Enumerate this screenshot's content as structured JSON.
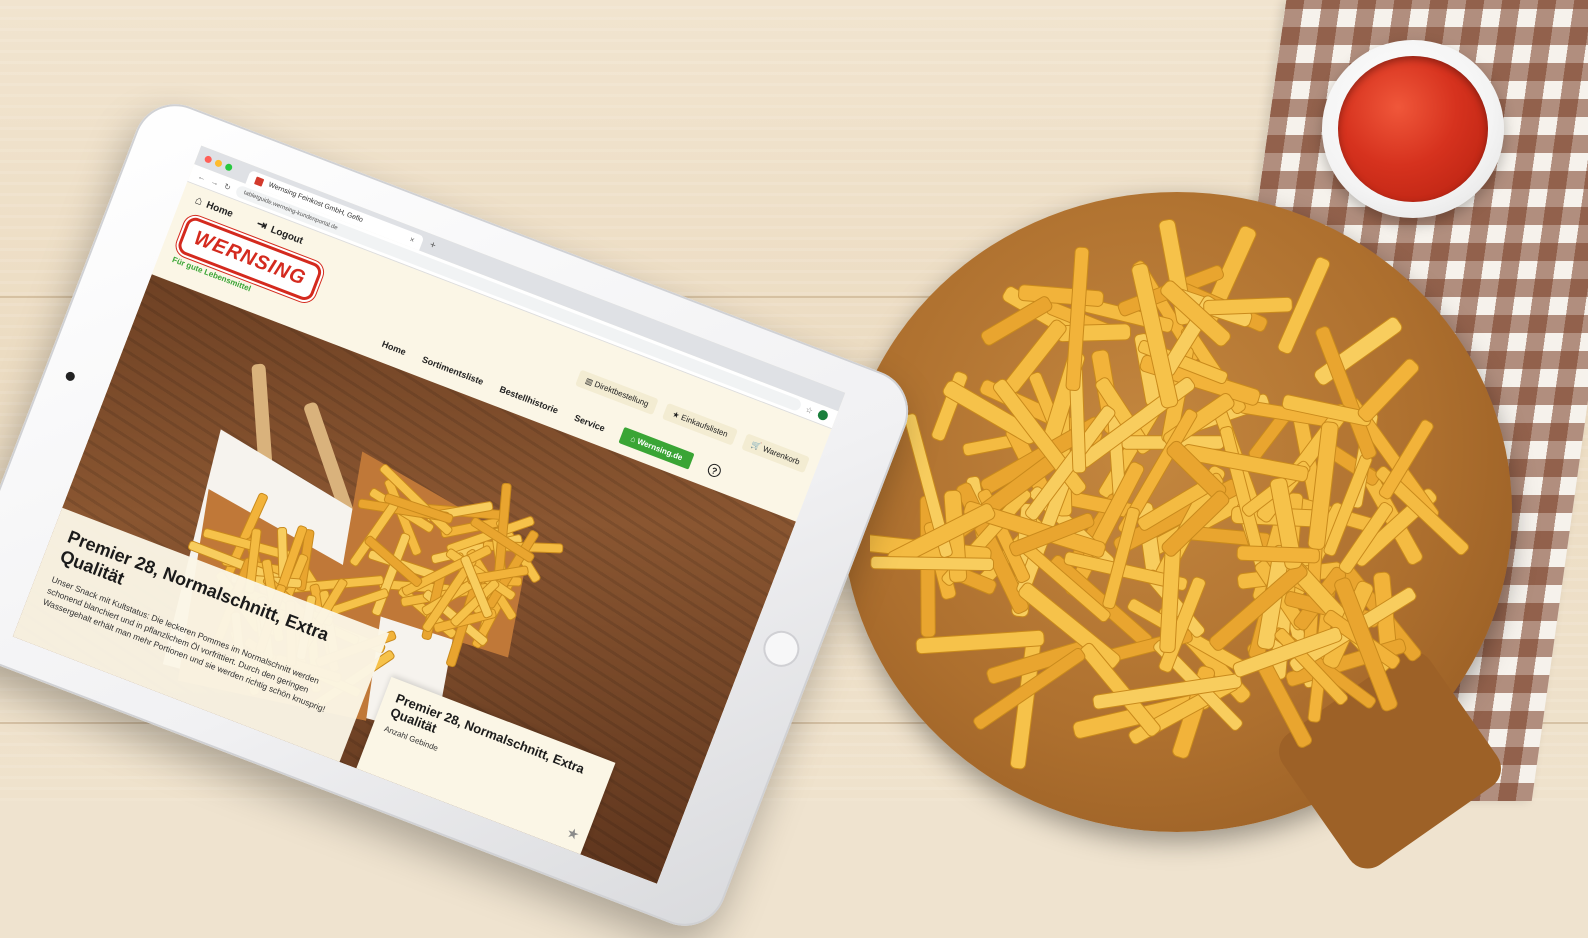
{
  "browser": {
    "tab_title": "Wernsing Feinkost GmbH, Geflo",
    "new_tab_symbol": "+",
    "url": "tabletguide.wernsing-kundenportal.de"
  },
  "site": {
    "top_nav": {
      "home_label": "Home",
      "logout_label": "Logout"
    },
    "logo_text": "WERNSING",
    "tagline": "Für gute Lebensmittel",
    "util": {
      "direct_order_label": "Direktbestellung",
      "shopping_list_label": "Einkaufslisten",
      "cart_label": "Warenkorb"
    },
    "main_nav": {
      "home": "Home",
      "assortment": "Sortimentsliste",
      "order_history": "Bestellhistorie",
      "service": "Service",
      "wernsing_button": "Wernsing.de",
      "help_symbol": "?"
    },
    "hero": {
      "title": "Premier 28, Normalschnitt, Extra Qualität",
      "description": "Unser Snack mit Kultstatus: Die leckeren Pommes im Normalschnitt werden schonend blanchiert und in pflanzlichem Öl vorfrittiert. Durch den geringen Wassergehalt erhält man mehr Portionen und sie werden richtig schön knusprig!"
    },
    "card": {
      "title": "Premier 28, Normalschnitt, Extra Qualität",
      "meta_label": "Anzahl Gebinde"
    }
  },
  "icons": {
    "home": "house-icon",
    "logout": "logout-icon",
    "direct_order": "barcode-icon",
    "shopping_list": "star-icon",
    "cart": "cart-icon",
    "favorite": "star-icon"
  },
  "colors": {
    "brand_red": "#d42a1e",
    "brand_green": "#3aa535",
    "page_cream": "#fbf6e6",
    "ketchup": "#d6321e",
    "fries": "#f3b43a"
  }
}
